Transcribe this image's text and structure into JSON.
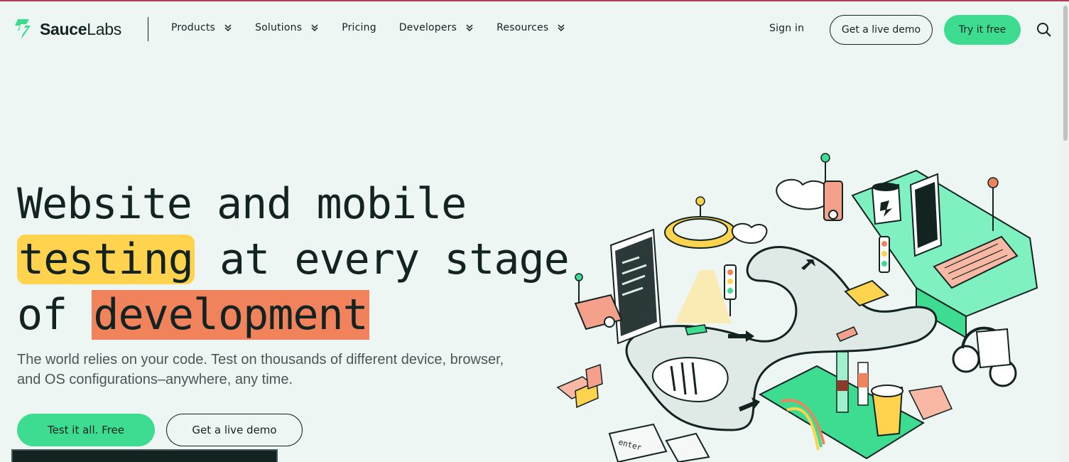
{
  "brand": {
    "name_bold": "Sauce",
    "name_light": "Labs",
    "accent": "#3ddc91",
    "dark": "#132322"
  },
  "nav": {
    "items": [
      {
        "label": "Products",
        "has_dropdown": true
      },
      {
        "label": "Solutions",
        "has_dropdown": true
      },
      {
        "label": "Pricing",
        "has_dropdown": false
      },
      {
        "label": "Developers",
        "has_dropdown": true
      },
      {
        "label": "Resources",
        "has_dropdown": true
      }
    ],
    "sign_in": "Sign in",
    "live_demo": "Get a live demo",
    "try_free": "Try it free",
    "search_icon": "search-icon"
  },
  "hero": {
    "line1": "Website and mobile",
    "line2_highlight": "testing",
    "line2_rest": " at every stage",
    "line3_prefix": "of ",
    "line3_highlight": "development",
    "highlight_yellow": "#ffd34e",
    "highlight_orange": "#f0835c",
    "subtext": "The world relies on your code. Test on thousands of different device, browser, and OS configurations–anywhere, any time.",
    "cta_primary": "Test it all. Free",
    "cta_secondary": "Get a live demo"
  },
  "illustration": {
    "keycap_text": "enter"
  }
}
